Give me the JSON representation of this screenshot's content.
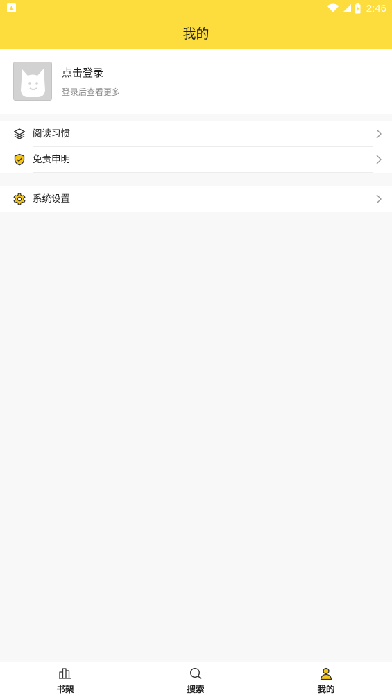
{
  "status_bar": {
    "time": "2:46"
  },
  "header": {
    "title": "我的"
  },
  "profile": {
    "name": "点击登录",
    "subtitle": "登录后查看更多"
  },
  "menu": {
    "group1": [
      {
        "label": "阅读习惯",
        "icon": "layers-icon"
      },
      {
        "label": "免责申明",
        "icon": "shield-check-icon"
      }
    ],
    "group2": [
      {
        "label": "系统设置",
        "icon": "gear-icon"
      }
    ]
  },
  "bottom_nav": {
    "items": [
      {
        "label": "书架",
        "icon": "bookshelf-icon"
      },
      {
        "label": "搜索",
        "icon": "search-icon"
      },
      {
        "label": "我的",
        "icon": "person-icon",
        "active": true
      }
    ]
  },
  "colors": {
    "accent": "#fddd3d",
    "icon_yellow": "#f5c518",
    "background": "#f8f8f8"
  }
}
